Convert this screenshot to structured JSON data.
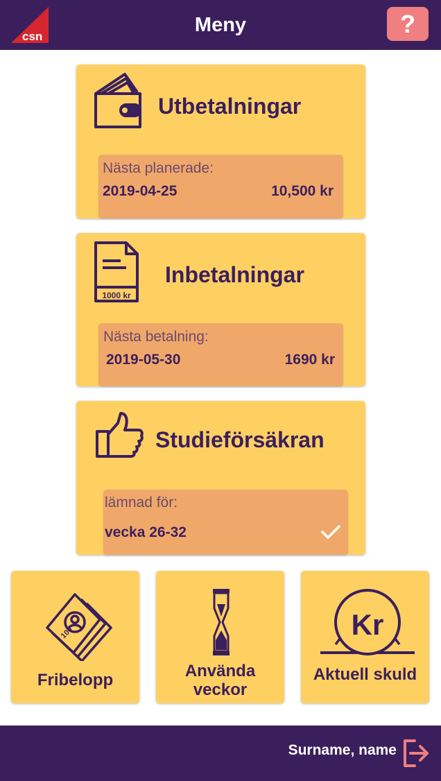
{
  "header": {
    "title": "Meny",
    "logo_text": "csn",
    "help_label": "?"
  },
  "cards": [
    {
      "title": "Utbetalningar",
      "label": "Nästa planerade:",
      "date": "2019-04-25",
      "amount": "10,500 kr",
      "icon": "wallet-icon"
    },
    {
      "title": "Inbetalningar",
      "label": "Nästa betalning:",
      "date": "2019-05-30",
      "amount": "1690 kr",
      "icon": "invoice-icon",
      "icon_text": "1000 kr"
    },
    {
      "title": "Studieförsäkran",
      "label": "lämnad för:",
      "value": "vecka 26-32",
      "status": "confirmed",
      "icon": "thumbs-up-icon",
      "status_icon": "checkmark-icon"
    }
  ],
  "tiles": [
    {
      "label": "Fribelopp",
      "icon": "banknotes-icon",
      "icon_text": "100"
    },
    {
      "label_line1": "Använda",
      "label_line2": "veckor",
      "icon": "hourglass-icon"
    },
    {
      "label": "Aktuell skuld",
      "icon": "coin-icon",
      "icon_text": "Kr"
    }
  ],
  "footer": {
    "user_name": "Surname, name",
    "logout_icon": "logout-icon"
  },
  "colors": {
    "primary": "#3b1f5c",
    "card": "#fed062",
    "info_box": "#f0a86a",
    "accent": "#ef7f80",
    "logo_red": "#d7262f"
  }
}
